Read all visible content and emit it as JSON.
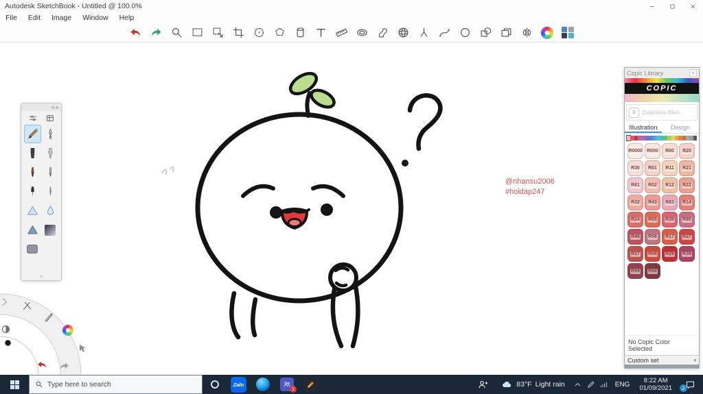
{
  "window": {
    "title": "Autodesk SketchBook - Untitled @ 100.0%"
  },
  "menu": {
    "items": [
      "File",
      "Edit",
      "Image",
      "Window",
      "Help"
    ]
  },
  "toolbar": {
    "icons": [
      {
        "name": "undo-icon",
        "color": "#c0392b"
      },
      {
        "name": "redo-icon",
        "color": "#2fa866"
      },
      {
        "name": "zoom-icon"
      },
      {
        "name": "rect-select-icon"
      },
      {
        "name": "transform-select-icon"
      },
      {
        "name": "crop-icon"
      },
      {
        "name": "distort-icon"
      },
      {
        "name": "polygon-select-icon"
      },
      {
        "name": "fill-icon"
      },
      {
        "name": "text-icon"
      },
      {
        "name": "ruler-icon"
      },
      {
        "name": "ellipse-guide-icon"
      },
      {
        "name": "french-curve-icon"
      },
      {
        "name": "perspective-icon"
      },
      {
        "name": "split-icon"
      },
      {
        "name": "curve-icon"
      },
      {
        "name": "circle-icon"
      },
      {
        "name": "shapes-icon"
      },
      {
        "name": "import-image-icon"
      },
      {
        "name": "symmetry-icon"
      },
      {
        "name": "color-wheel-icon"
      },
      {
        "name": "copic-palette-icon"
      }
    ]
  },
  "tool_palette": {
    "header_buttons": [
      "settings-sliders-icon",
      "brush-table-icon"
    ],
    "tools": [
      {
        "name": "pencil-tool",
        "selected": true
      },
      {
        "name": "fountain-pen-tool"
      },
      {
        "name": "marker-tool"
      },
      {
        "name": "airbrush-tool"
      },
      {
        "name": "paintbrush-tool"
      },
      {
        "name": "graphite-pencil-tool"
      },
      {
        "name": "ink-pen-tool"
      },
      {
        "name": "needle-pen-tool"
      },
      {
        "name": "triangle-tool"
      },
      {
        "name": "water-drop-tool"
      },
      {
        "name": "shading-triangle-tool"
      },
      {
        "name": "gradient-tool"
      },
      {
        "name": "eraser-block-tool"
      }
    ]
  },
  "canvas": {
    "watermark_line1": "@nhansu2006",
    "watermark_line2": "#hoidap247",
    "watermark_color": "#e05050"
  },
  "copic": {
    "title": "Copic Library",
    "brand": "COPIC",
    "blender_code": "0",
    "blender_label": "Colorless Blen..",
    "tabs": [
      {
        "label": "Illustration",
        "active": true
      },
      {
        "label": "Design",
        "active": false
      }
    ],
    "family_colors": [
      "#f2b8c6",
      "#e05a5a",
      "#c23b4e",
      "#c95f9b",
      "#9b6bb5",
      "#7d6fc0",
      "#5f7fd0",
      "#4f9fd8",
      "#52bcd4",
      "#4fbfa8",
      "#6abf7a",
      "#a8cc66",
      "#e8d45f",
      "#e8a84f",
      "#e08648",
      "#b57a52",
      "#b0a8a0",
      "#9aa0a8",
      "#5a5a5a"
    ],
    "swatches": [
      {
        "code": "R0000",
        "color": "#f9ece5"
      },
      {
        "code": "R000",
        "color": "#f8e7de"
      },
      {
        "code": "R00",
        "color": "#f6dfd4"
      },
      {
        "code": "R20",
        "color": "#f5d2c8"
      },
      {
        "code": "R30",
        "color": "#f7dcd9"
      },
      {
        "code": "R01",
        "color": "#f4d0c5"
      },
      {
        "code": "R11",
        "color": "#f6d2be"
      },
      {
        "code": "R21",
        "color": "#efb8a2"
      },
      {
        "code": "R81",
        "color": "#efc6cf"
      },
      {
        "code": "R02",
        "color": "#f2bdae"
      },
      {
        "code": "R12",
        "color": "#f2c0a7"
      },
      {
        "code": "R22",
        "color": "#e9a08f"
      },
      {
        "code": "R32",
        "color": "#f0aba0"
      },
      {
        "code": "R43",
        "color": "#e89a93"
      },
      {
        "code": "R83",
        "color": "#e9a8b8"
      },
      {
        "code": "R14",
        "color": "#e08078"
      },
      {
        "code": "R24",
        "color": "#dc6e6a"
      },
      {
        "code": "R05",
        "color": "#dd6b55"
      },
      {
        "code": "R35",
        "color": "#da6275"
      },
      {
        "code": "R85",
        "color": "#c96d85"
      },
      {
        "code": "R46",
        "color": "#bc5462"
      },
      {
        "code": "R56",
        "color": "#bc7680"
      },
      {
        "code": "R17",
        "color": "#d55f4a"
      },
      {
        "code": "R27",
        "color": "#cd4646"
      },
      {
        "code": "R37",
        "color": "#bc5150"
      },
      {
        "code": "R08",
        "color": "#cb4a3c"
      },
      {
        "code": "R29",
        "color": "#bd3039"
      },
      {
        "code": "R39",
        "color": "#ab4463"
      },
      {
        "code": "R59",
        "color": "#94414f"
      },
      {
        "code": "R89",
        "color": "#7d3a3f"
      }
    ],
    "no_selection": "No Copic Color Selected",
    "custom_set": "Custom set"
  },
  "corner": {
    "icons": [
      "chevron-right-icon",
      "edit-tools-icon",
      "stylus-star-icon",
      "color-wheel-icon",
      "contrast-icon",
      "black-dot-icon",
      "cursor-icon",
      "undo-icon",
      "redo-icon"
    ]
  },
  "taskbar": {
    "search_placeholder": "Type here to search",
    "apps": [
      {
        "name": "cortana",
        "icon": "cortana-icon"
      },
      {
        "name": "zalo",
        "icon": "zalo-icon",
        "label": "Zalo"
      },
      {
        "name": "edge",
        "icon": "edge-icon"
      },
      {
        "name": "teams",
        "icon": "teams-icon",
        "badge": "1"
      },
      {
        "name": "sketchbook",
        "icon": "sketchbook-icon"
      }
    ],
    "tray_icons": [
      "chevron-up-icon",
      "pen-tray-icon",
      "signal-icon"
    ],
    "weather": {
      "temp": "83°F",
      "condition": "Light rain"
    },
    "language": "ENG",
    "time": "8:22 AM",
    "date": "01/09/2021",
    "notification_count": "2"
  }
}
